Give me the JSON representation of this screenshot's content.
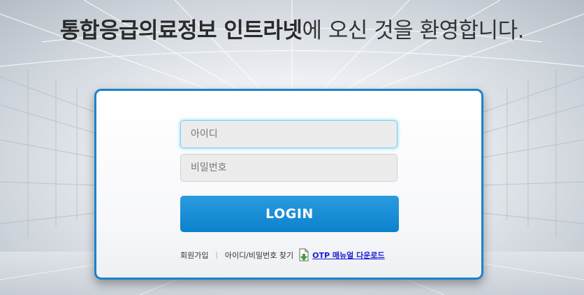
{
  "header": {
    "title_bold": "통합응급의료정보 인트라넷",
    "title_rest": "에 오신 것을 환영합니다."
  },
  "login": {
    "id_placeholder": "아이디",
    "pw_placeholder": "비밀번호",
    "button_label": "LOGIN"
  },
  "links": {
    "signup": "회원가입",
    "separator": "|",
    "find": "아이디/비밀번호 찾기",
    "otp_manual": "OTP 매뉴얼 다운로드"
  },
  "colors": {
    "accent": "#1a83c9",
    "button": "#0a82cc",
    "link": "#1a1ad6"
  },
  "icons": {
    "otp": "download-icon"
  }
}
